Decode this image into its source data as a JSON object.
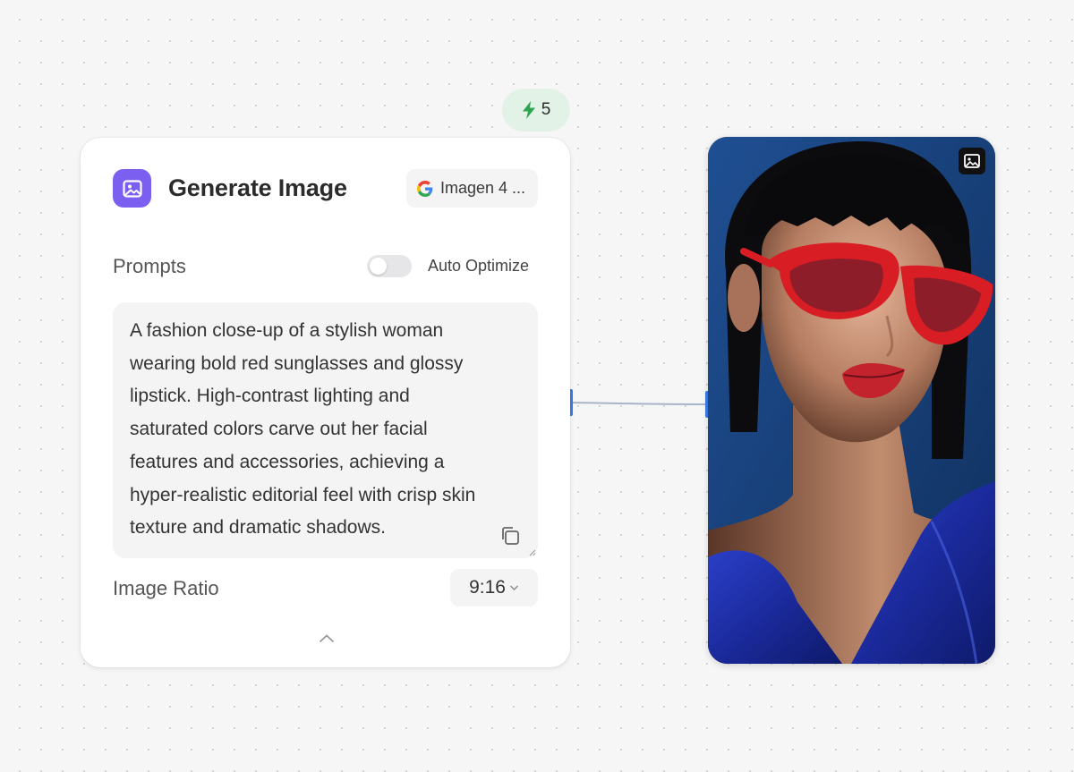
{
  "credits": {
    "icon": "lightning-icon",
    "value": "5",
    "color": "#2fa44f"
  },
  "node": {
    "icon": "image-icon",
    "title": "Generate Image",
    "accent": "#7b5ff0",
    "model": {
      "icon": "google-logo-icon",
      "label": "Imagen 4 ..."
    },
    "prompts": {
      "label": "Prompts",
      "auto_optimize_label": "Auto Optimize",
      "auto_optimize_on": false,
      "text": "A fashion close-up of a stylish woman\nwearing bold red sunglasses and glossy\nlipstick. High-contrast lighting and\nsaturated colors carve out her facial\nfeatures and accessories, achieving a\nhyper-realistic editorial feel with crisp skin\ntexture and dramatic shadows."
    },
    "ratio": {
      "label": "Image Ratio",
      "value": "9:16"
    },
    "collapse_icon": "chevron-up-icon"
  },
  "output": {
    "badge_icon": "image-icon",
    "connector_color": "#3b7be8"
  }
}
